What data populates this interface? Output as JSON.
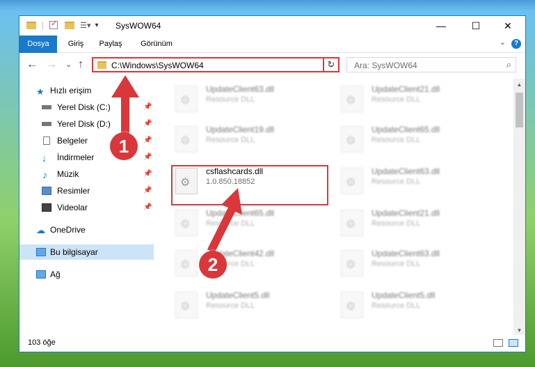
{
  "window": {
    "title": "SysWOW64",
    "controls": {
      "minimize": "—",
      "maximize": "☐",
      "close": "✕"
    }
  },
  "ribbon": {
    "tabs": [
      "Dosya",
      "Giriş",
      "Paylaş",
      "Görünüm"
    ],
    "help": "?",
    "collapse": "⌄"
  },
  "nav": {
    "back": "←",
    "forward": "→",
    "recent": "⌄",
    "up": "↑",
    "address": "C:\\Windows\\SysWOW64",
    "address_drop": "⌄",
    "refresh": "↻",
    "search_placeholder": "Ara: SysWOW64",
    "search_icon": "⌕"
  },
  "sidebar": {
    "items": [
      {
        "label": "Hızlı erişim",
        "icon": "star-icon",
        "pinned": false
      },
      {
        "label": "Yerel Disk (C:)",
        "icon": "drive-icon",
        "pinned": true
      },
      {
        "label": "Yerel Disk (D:)",
        "icon": "drive-icon",
        "pinned": true
      },
      {
        "label": "Belgeler",
        "icon": "document-icon",
        "pinned": true
      },
      {
        "label": "İndirmeler",
        "icon": "download-icon",
        "pinned": true
      },
      {
        "label": "Müzik",
        "icon": "music-icon",
        "pinned": true
      },
      {
        "label": "Resimler",
        "icon": "pictures-icon",
        "pinned": true
      },
      {
        "label": "Videolar",
        "icon": "video-icon",
        "pinned": true
      },
      {
        "label": "OneDrive",
        "icon": "cloud-icon",
        "pinned": false
      },
      {
        "label": "Bu bilgisayar",
        "icon": "computer-icon",
        "pinned": false,
        "selected": true
      },
      {
        "label": "Ağ",
        "icon": "network-icon",
        "pinned": false
      }
    ],
    "pin_glyph": "📌"
  },
  "files": {
    "left_column": [
      {
        "name": "UpdateClient63.dll",
        "sub": "Resource DLL"
      },
      {
        "name": "UpdateClient19.dll",
        "sub": "Resource DLL"
      },
      {
        "name": "csflashcards.dll",
        "sub": "1.0.850.18852",
        "highlight": true
      },
      {
        "name": "UpdateClient65.dll",
        "sub": "Resource DLL"
      },
      {
        "name": "UpdateClient42.dll",
        "sub": "Resource DLL"
      },
      {
        "name": "UpdateClient5.dll",
        "sub": "Resource DLL"
      }
    ],
    "right_column": [
      {
        "name": "UpdateClient21.dll",
        "sub": "Resource DLL"
      },
      {
        "name": "UpdateClient65.dll",
        "sub": "Resource DLL"
      },
      {
        "name": "UpdateClient63.dll",
        "sub": "Resource DLL"
      },
      {
        "name": "UpdateClient21.dll",
        "sub": "Resource DLL"
      },
      {
        "name": "UpdateClient63.dll",
        "sub": "Resource DLL"
      },
      {
        "name": "UpdateClient5.dll",
        "sub": "Resource DLL"
      }
    ]
  },
  "status": {
    "count": "103 öğe"
  },
  "annotations": {
    "step1": "1",
    "step2": "2"
  },
  "colors": {
    "accent": "#1979ca",
    "highlight": "#d9373a",
    "selected": "#cce4f7"
  }
}
